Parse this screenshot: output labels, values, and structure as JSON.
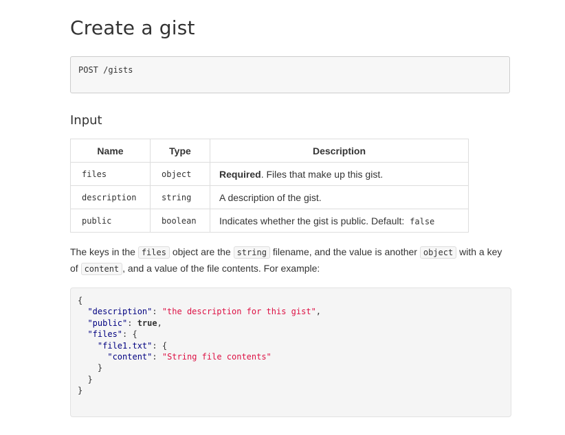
{
  "title": "Create a gist",
  "endpoint": "POST /gists",
  "input_heading": "Input",
  "table": {
    "headers": [
      "Name",
      "Type",
      "Description"
    ],
    "rows": [
      {
        "name": "files",
        "type": "object",
        "desc_strong": "Required",
        "desc": ". Files that make up this gist."
      },
      {
        "name": "description",
        "type": "string",
        "desc": "A description of the gist."
      },
      {
        "name": "public",
        "type": "boolean",
        "desc": "Indicates whether the gist is public. Default: ",
        "default": "false"
      }
    ]
  },
  "paragraph": {
    "part1": "The keys in the ",
    "code1": "files",
    "part2": " object are the ",
    "code2": "string",
    "part3": " filename, and the value is another ",
    "code3": "object",
    "part4": " with a key of ",
    "code4": "content",
    "part5": ", and a value of the file contents. For example:"
  },
  "example": {
    "open": "{",
    "k_description": "\"description\"",
    "v_description": "\"the description for this gist\"",
    "k_public": "\"public\"",
    "v_public": "true",
    "k_files": "\"files\"",
    "k_file1": "\"file1.txt\"",
    "k_content": "\"content\"",
    "v_content": "\"String file contents\"",
    "close": "}"
  },
  "colors": {
    "json_key": "#000080",
    "json_string": "#dd1144",
    "border": "#dddddd"
  }
}
